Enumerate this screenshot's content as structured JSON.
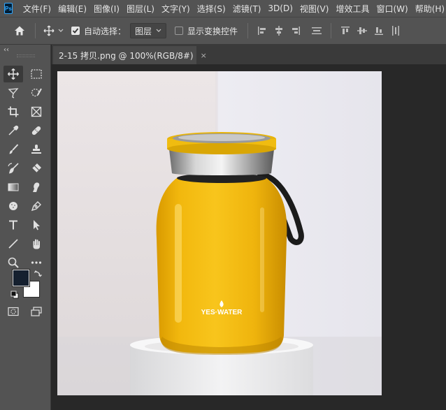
{
  "app": {
    "logo_text": "Ps"
  },
  "menu": [
    "文件(F)",
    "编辑(E)",
    "图像(I)",
    "图层(L)",
    "文字(Y)",
    "选择(S)",
    "滤镜(T)",
    "3D(D)",
    "视图(V)",
    "增效工具",
    "窗口(W)",
    "帮助(H)"
  ],
  "options": {
    "auto_select_label": "自动选择：",
    "auto_select_checked": true,
    "auto_select_target": "图层",
    "show_transform_label": "显示变换控件",
    "show_transform_checked": false
  },
  "tab": {
    "title": "2-15 拷贝.png @ 100%(RGB/8#)",
    "close": "×"
  },
  "panel": {
    "collapse": "‹‹"
  },
  "tools": [
    {
      "name": "move-tool",
      "active": true
    },
    {
      "name": "rect-marquee-tool"
    },
    {
      "name": "lasso-tool"
    },
    {
      "name": "object-select-tool"
    },
    {
      "name": "crop-tool"
    },
    {
      "name": "frame-tool"
    },
    {
      "name": "eyedropper-tool"
    },
    {
      "name": "healing-brush-tool"
    },
    {
      "name": "brush-tool"
    },
    {
      "name": "clone-stamp-tool"
    },
    {
      "name": "history-brush-tool"
    },
    {
      "name": "eraser-tool"
    },
    {
      "name": "gradient-tool"
    },
    {
      "name": "smudge-tool"
    },
    {
      "name": "dodge-tool"
    },
    {
      "name": "pen-tool"
    },
    {
      "name": "type-tool"
    },
    {
      "name": "path-select-tool"
    },
    {
      "name": "line-tool"
    },
    {
      "name": "hand-tool"
    },
    {
      "name": "zoom-tool"
    },
    {
      "name": "more-tools"
    }
  ],
  "colors": {
    "foreground": "#15202f",
    "background": "#ffffff"
  },
  "image": {
    "brand_text": "YES·WATER"
  }
}
